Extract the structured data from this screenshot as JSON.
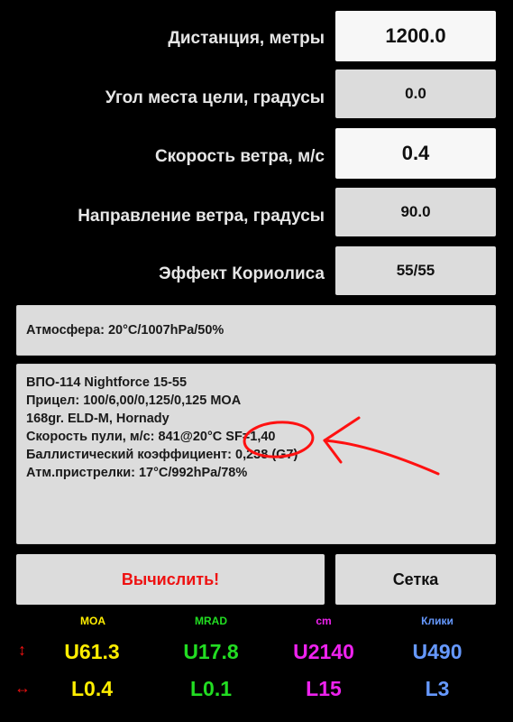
{
  "fields": [
    {
      "label": "Дистанция, метры",
      "value": "1200.0"
    },
    {
      "label": "Угол места цели, градусы",
      "value": "0.0"
    },
    {
      "label": "Скорость ветра, м/с",
      "value": "0.4"
    },
    {
      "label": "Направление ветра, градусы",
      "value": "90.0"
    },
    {
      "label": "Эффект Кориолиса",
      "value": "55/55"
    }
  ],
  "atmosphere": "Атмосфера: 20°C/1007hPa/50%",
  "info_lines": [
    "ВПО-114 Nightforce 15-55",
    "Прицел: 100/6,00/0,125/0,125 MOA",
    "168gr. ELD-M, Hornady",
    "Скорость пули, м/с: 841@20°C SF=1,40",
    "Баллистический коэффициент: 0,238 (G7)",
    "Атм.пристрелки: 17°C/992hPa/78%"
  ],
  "buttons": {
    "calculate": "Вычислить!",
    "grid": "Сетка"
  },
  "results": {
    "headers": [
      "MOA",
      "MRAD",
      "cm",
      "Клики"
    ],
    "up": [
      "U61.3",
      "U17.8",
      "U2140",
      "U490"
    ],
    "left": [
      "L0.4",
      "L0.1",
      "L15",
      "L3"
    ]
  },
  "colors": {
    "moa": "#ffee00",
    "mrad": "#22dd22",
    "cm": "#ee22ee",
    "clicks": "#6699ff",
    "calculate_text": "#ee1111",
    "annotation": "#ff1111"
  },
  "icons": {
    "vertical": "up-down-arrow-icon",
    "horizontal": "left-right-arrow-icon"
  }
}
